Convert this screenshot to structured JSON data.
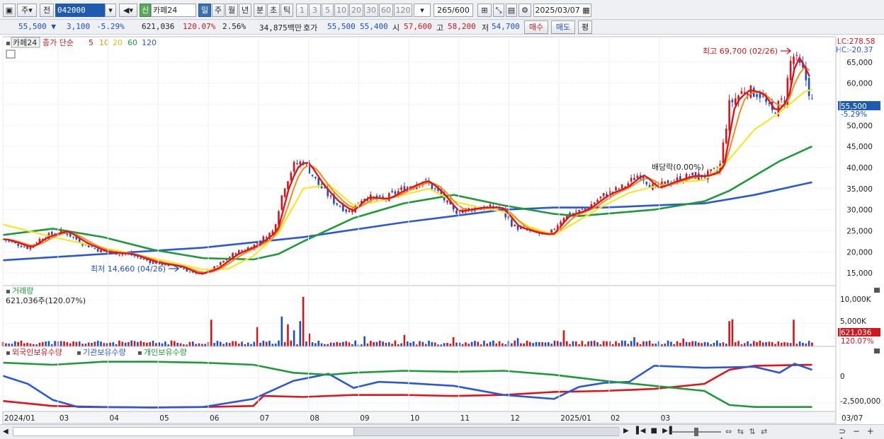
{
  "toolbar": {
    "mode_ju": "주",
    "mode_jeon": "전",
    "code": "042000",
    "shin": "신",
    "stock_name": "카페24",
    "periods": [
      "일",
      "주",
      "월",
      "년",
      "분",
      "초",
      "틱"
    ],
    "active_period": "일",
    "ticks": [
      "1",
      "3",
      "5",
      "10",
      "20",
      "30",
      "60",
      "120"
    ],
    "count": "265",
    "count_max": "/600",
    "date": "2025/03/07"
  },
  "quote": {
    "price": "55,500",
    "change": "3,100",
    "pct": "-5.29%",
    "volume": "621,036",
    "vol_ratio": "120.07%",
    "turnover": "2.56%",
    "amount": "34,875백만",
    "ask_label": "호가",
    "ask": "55,500",
    "bid": "55,400",
    "open_label": "시",
    "open": "57,600",
    "high_label": "고",
    "high": "58,200",
    "low_label": "저",
    "low": "54,700",
    "buy": "매수",
    "sell": "매도",
    "avg": "평"
  },
  "colors": {
    "up": "#d0161e",
    "down": "#1a4fc7",
    "ma5": "#e0141c",
    "ma10": "#f08c1c",
    "ma20": "#f5e62a",
    "ma60": "#1e9a3a",
    "ma120": "#2a58d8",
    "foreign": "#e0141c",
    "institution": "#2a58d8",
    "individual": "#1e9a3a"
  },
  "chart_data": [
    {
      "type": "line",
      "title": "카페24",
      "price_legend": {
        "label": "종가 단순",
        "periods": [
          "5",
          "10",
          "20",
          "60",
          "120"
        ]
      },
      "x_ticks": [
        "2024/01",
        "03",
        "04",
        "05",
        "06",
        "07",
        "08",
        "09",
        "10",
        "11",
        "12",
        "2025/01",
        "02",
        "03",
        "03/07"
      ],
      "y_ticks": [
        "65,000",
        "60,000",
        "55,000",
        "50,000",
        "45,000",
        "40,000",
        "35,000",
        "30,000",
        "25,000",
        "20,000",
        "15,000"
      ],
      "ylim": [
        12000,
        71000
      ],
      "lc": "LC:278.58",
      "hc": "HC:-20.37",
      "high_note": "최고 69,700 (02/26)",
      "low_note": "최저 14,660 (04/26)",
      "dividend_note": "배당락(0.00%)",
      "price_tag": "55,500",
      "pct_tag": "-5.29%",
      "close": [
        {
          "m": 0,
          "v": 23000
        },
        {
          "m": 0.5,
          "v": 21000
        },
        {
          "m": 0.8,
          "v": 23500
        },
        {
          "m": 1.2,
          "v": 25000
        },
        {
          "m": 1.6,
          "v": 22000
        },
        {
          "m": 2.0,
          "v": 20000
        },
        {
          "m": 2.5,
          "v": 19500
        },
        {
          "m": 3.0,
          "v": 17500
        },
        {
          "m": 3.5,
          "v": 16500
        },
        {
          "m": 3.85,
          "v": 14660
        },
        {
          "m": 4.2,
          "v": 16000
        },
        {
          "m": 4.6,
          "v": 19500
        },
        {
          "m": 5.0,
          "v": 21500
        },
        {
          "m": 5.4,
          "v": 25000
        },
        {
          "m": 5.6,
          "v": 35000
        },
        {
          "m": 5.8,
          "v": 40500
        },
        {
          "m": 6.0,
          "v": 41500
        },
        {
          "m": 6.3,
          "v": 36000
        },
        {
          "m": 6.6,
          "v": 32000
        },
        {
          "m": 6.9,
          "v": 29500
        },
        {
          "m": 7.2,
          "v": 33000
        },
        {
          "m": 7.6,
          "v": 32500
        },
        {
          "m": 8.0,
          "v": 35000
        },
        {
          "m": 8.4,
          "v": 37000
        },
        {
          "m": 8.7,
          "v": 34000
        },
        {
          "m": 9.0,
          "v": 29500
        },
        {
          "m": 9.5,
          "v": 30500
        },
        {
          "m": 9.9,
          "v": 30500
        },
        {
          "m": 10.2,
          "v": 26000
        },
        {
          "m": 10.6,
          "v": 24500
        },
        {
          "m": 10.9,
          "v": 24000
        },
        {
          "m": 11.2,
          "v": 28500
        },
        {
          "m": 11.6,
          "v": 30000
        },
        {
          "m": 12.0,
          "v": 33500
        },
        {
          "m": 12.4,
          "v": 35500
        },
        {
          "m": 12.7,
          "v": 38500
        },
        {
          "m": 13.0,
          "v": 35000
        },
        {
          "m": 13.3,
          "v": 36500
        },
        {
          "m": 13.7,
          "v": 38000
        },
        {
          "m": 14.0,
          "v": 38000
        },
        {
          "m": 14.3,
          "v": 39500
        },
        {
          "m": 14.5,
          "v": 55000
        },
        {
          "m": 14.8,
          "v": 58500
        },
        {
          "m": 15.1,
          "v": 57500
        },
        {
          "m": 15.35,
          "v": 53000
        },
        {
          "m": 15.6,
          "v": 56500
        },
        {
          "m": 15.75,
          "v": 67000
        },
        {
          "m": 16.0,
          "v": 62000
        },
        {
          "m": 16.15,
          "v": 55500
        }
      ],
      "ma20": [
        {
          "m": 0,
          "v": 26500
        },
        {
          "m": 1.0,
          "v": 23500
        },
        {
          "m": 2.0,
          "v": 21000
        },
        {
          "m": 3.0,
          "v": 18500
        },
        {
          "m": 4.0,
          "v": 15800
        },
        {
          "m": 4.5,
          "v": 16000
        },
        {
          "m": 5.0,
          "v": 19000
        },
        {
          "m": 5.5,
          "v": 24500
        },
        {
          "m": 6.0,
          "v": 35000
        },
        {
          "m": 6.5,
          "v": 36000
        },
        {
          "m": 7.0,
          "v": 31000
        },
        {
          "m": 7.5,
          "v": 32000
        },
        {
          "m": 8.0,
          "v": 33500
        },
        {
          "m": 8.5,
          "v": 35000
        },
        {
          "m": 9.0,
          "v": 32000
        },
        {
          "m": 9.5,
          "v": 30500
        },
        {
          "m": 10.0,
          "v": 29500
        },
        {
          "m": 10.5,
          "v": 26000
        },
        {
          "m": 11.0,
          "v": 24000
        },
        {
          "m": 11.5,
          "v": 27500
        },
        {
          "m": 12.0,
          "v": 31000
        },
        {
          "m": 12.5,
          "v": 34000
        },
        {
          "m": 13.0,
          "v": 35500
        },
        {
          "m": 13.5,
          "v": 36500
        },
        {
          "m": 14.0,
          "v": 37000
        },
        {
          "m": 14.5,
          "v": 42000
        },
        {
          "m": 15.0,
          "v": 49000
        },
        {
          "m": 15.5,
          "v": 53000
        },
        {
          "m": 16.0,
          "v": 58000
        },
        {
          "m": 16.15,
          "v": 58500
        }
      ],
      "ma60": [
        {
          "m": 0,
          "v": 24000
        },
        {
          "m": 1.0,
          "v": 25500
        },
        {
          "m": 2.0,
          "v": 23500
        },
        {
          "m": 3.0,
          "v": 20500
        },
        {
          "m": 4.0,
          "v": 18500
        },
        {
          "m": 5.0,
          "v": 18200
        },
        {
          "m": 5.5,
          "v": 19500
        },
        {
          "m": 6.0,
          "v": 22500
        },
        {
          "m": 7.0,
          "v": 28000
        },
        {
          "m": 8.0,
          "v": 31500
        },
        {
          "m": 9.0,
          "v": 33500
        },
        {
          "m": 10.0,
          "v": 31000
        },
        {
          "m": 11.0,
          "v": 29000
        },
        {
          "m": 11.5,
          "v": 28500
        },
        {
          "m": 12.0,
          "v": 29000
        },
        {
          "m": 13.0,
          "v": 30000
        },
        {
          "m": 14.0,
          "v": 32000
        },
        {
          "m": 14.5,
          "v": 34500
        },
        {
          "m": 15.0,
          "v": 38000
        },
        {
          "m": 15.5,
          "v": 41500
        },
        {
          "m": 16.15,
          "v": 45000
        }
      ],
      "ma120": [
        {
          "m": 0,
          "v": 18000
        },
        {
          "m": 2.0,
          "v": 19500
        },
        {
          "m": 4.0,
          "v": 21000
        },
        {
          "m": 6.0,
          "v": 23500
        },
        {
          "m": 8.0,
          "v": 27000
        },
        {
          "m": 10.0,
          "v": 30000
        },
        {
          "m": 11.0,
          "v": 30500
        },
        {
          "m": 12.0,
          "v": 30500
        },
        {
          "m": 13.0,
          "v": 31000
        },
        {
          "m": 14.0,
          "v": 31500
        },
        {
          "m": 15.0,
          "v": 33500
        },
        {
          "m": 16.15,
          "v": 36500
        }
      ]
    },
    {
      "type": "bar",
      "title": "거래량",
      "subtitle": "621,036주(120.07%)",
      "y_ticks": [
        "10,000K",
        "5,000K"
      ],
      "ylim": [
        0,
        12000000
      ],
      "last_tag": "621,036",
      "last_pct": "120.07%",
      "spikes": [
        {
          "m": 4.15,
          "v": 5800000
        },
        {
          "m": 5.05,
          "v": 4200000
        },
        {
          "m": 5.55,
          "v": 6500000
        },
        {
          "m": 5.7,
          "v": 4800000
        },
        {
          "m": 5.8,
          "v": 3500000
        },
        {
          "m": 6.0,
          "v": 10800000
        },
        {
          "m": 5.95,
          "v": 5500000
        },
        {
          "m": 6.1,
          "v": 2800000
        },
        {
          "m": 7.2,
          "v": 2200000
        },
        {
          "m": 8.0,
          "v": 2500000
        },
        {
          "m": 9.0,
          "v": 2000000
        },
        {
          "m": 10.3,
          "v": 1800000
        },
        {
          "m": 11.2,
          "v": 3500000
        },
        {
          "m": 12.6,
          "v": 2000000
        },
        {
          "m": 13.6,
          "v": 1700000
        },
        {
          "m": 14.5,
          "v": 5500000
        },
        {
          "m": 14.55,
          "v": 5900000
        },
        {
          "m": 15.8,
          "v": 5800000
        }
      ]
    },
    {
      "type": "line",
      "title": "외국인보유수량",
      "series": [
        {
          "name": "외국인보유수량",
          "values": [
            {
              "m": 0,
              "v": -2300000
            },
            {
              "m": 1.0,
              "v": -2800000
            },
            {
              "m": 2.0,
              "v": -2900000
            },
            {
              "m": 3.0,
              "v": -2950000
            },
            {
              "m": 4.0,
              "v": -2900000
            },
            {
              "m": 5.0,
              "v": -2800000
            },
            {
              "m": 5.2,
              "v": -1800000
            },
            {
              "m": 6.0,
              "v": -1900000
            },
            {
              "m": 7.0,
              "v": -1700000
            },
            {
              "m": 8.0,
              "v": -1700000
            },
            {
              "m": 9.0,
              "v": -1800000
            },
            {
              "m": 10.0,
              "v": -1700000
            },
            {
              "m": 11.0,
              "v": -1400000
            },
            {
              "m": 12.0,
              "v": -1300000
            },
            {
              "m": 13.0,
              "v": -1100000
            },
            {
              "m": 14.0,
              "v": -600000
            },
            {
              "m": 14.5,
              "v": 800000
            },
            {
              "m": 15.0,
              "v": 1200000
            },
            {
              "m": 16.15,
              "v": 1300000
            }
          ]
        },
        {
          "name": "기관보유수량",
          "values": [
            {
              "m": 0,
              "v": 200000
            },
            {
              "m": 0.5,
              "v": -600000
            },
            {
              "m": 1.0,
              "v": -2200000
            },
            {
              "m": 1.5,
              "v": -2900000
            },
            {
              "m": 3.0,
              "v": -2950000
            },
            {
              "m": 4.0,
              "v": -2900000
            },
            {
              "m": 5.0,
              "v": -2100000
            },
            {
              "m": 5.8,
              "v": -300000
            },
            {
              "m": 6.5,
              "v": 400000
            },
            {
              "m": 7.0,
              "v": -1000000
            },
            {
              "m": 7.5,
              "v": -400000
            },
            {
              "m": 8.0,
              "v": -500000
            },
            {
              "m": 9.0,
              "v": -800000
            },
            {
              "m": 10.0,
              "v": -1700000
            },
            {
              "m": 11.0,
              "v": -2100000
            },
            {
              "m": 11.5,
              "v": -900000
            },
            {
              "m": 12.0,
              "v": -500000
            },
            {
              "m": 12.5,
              "v": -400000
            },
            {
              "m": 13.0,
              "v": 1200000
            },
            {
              "m": 14.0,
              "v": 1000000
            },
            {
              "m": 15.0,
              "v": 1100000
            },
            {
              "m": 15.5,
              "v": 500000
            },
            {
              "m": 15.8,
              "v": 1400000
            },
            {
              "m": 16.15,
              "v": 800000
            }
          ]
        },
        {
          "name": "개인보유수량",
          "values": [
            {
              "m": 0,
              "v": 1500000
            },
            {
              "m": 1.0,
              "v": 1300000
            },
            {
              "m": 2.0,
              "v": 1600000
            },
            {
              "m": 3.0,
              "v": 1600000
            },
            {
              "m": 4.0,
              "v": 1500000
            },
            {
              "m": 5.0,
              "v": 1300000
            },
            {
              "m": 5.8,
              "v": 500000
            },
            {
              "m": 6.5,
              "v": 300000
            },
            {
              "m": 7.0,
              "v": 500000
            },
            {
              "m": 8.0,
              "v": 700000
            },
            {
              "m": 9.0,
              "v": 600000
            },
            {
              "m": 10.0,
              "v": 700000
            },
            {
              "m": 11.0,
              "v": 300000
            },
            {
              "m": 12.0,
              "v": -300000
            },
            {
              "m": 13.0,
              "v": -800000
            },
            {
              "m": 14.0,
              "v": -1300000
            },
            {
              "m": 14.5,
              "v": -2700000
            },
            {
              "m": 15.0,
              "v": -2900000
            },
            {
              "m": 16.15,
              "v": -2900000
            }
          ]
        }
      ],
      "y_ticks": [
        "0",
        "-2,500,000"
      ],
      "ylim": [
        -3200000,
        2000000
      ]
    }
  ]
}
